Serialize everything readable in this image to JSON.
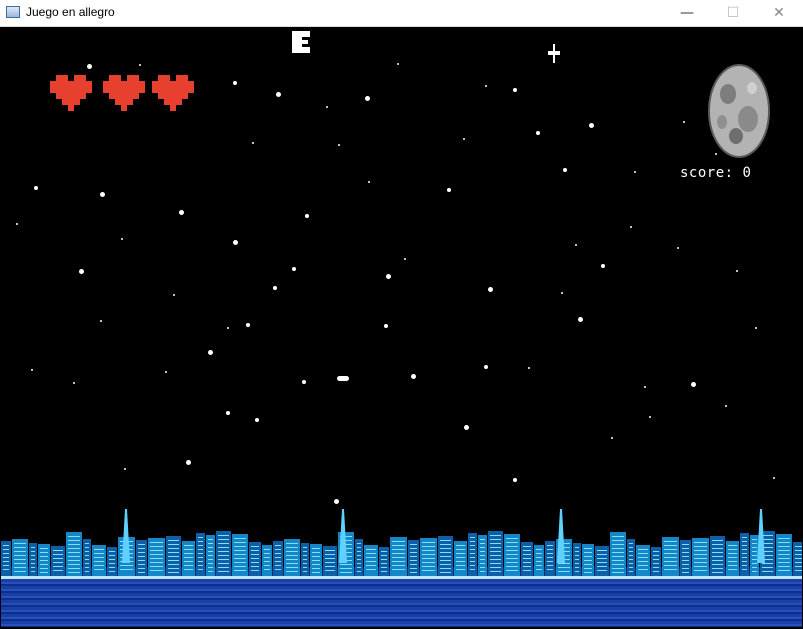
{
  "window": {
    "title": "Juego en allegro",
    "minimize_glyph": "—",
    "maximize_glyph": "☐",
    "close_glyph": "✕"
  },
  "hud": {
    "lives": 3,
    "score_text": "score: 0"
  },
  "colors": {
    "heart": "#e8402e",
    "sky": "#000000",
    "city": "#1ba8e6",
    "water": "#1a3fa8"
  },
  "icons": {
    "heart": "heart-icon",
    "moon": "moon-icon",
    "player": "spaceship-icon",
    "enemy": "enemy-ship-icon"
  }
}
